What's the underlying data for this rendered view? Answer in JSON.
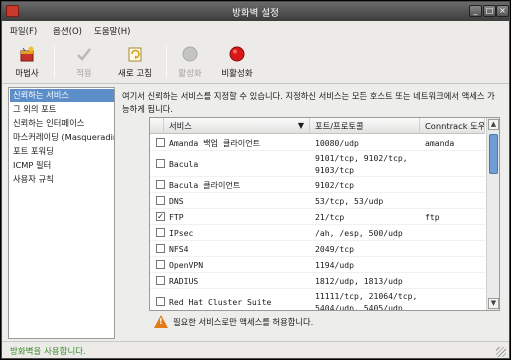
{
  "window": {
    "title": "방화벽 설정",
    "controls": [
      "_",
      "□",
      "×"
    ]
  },
  "menu": {
    "file": "파일(F)",
    "options": "옵션(O)",
    "help": "도움말(H)"
  },
  "toolbar": {
    "wizard": "마법사",
    "apply": "적용",
    "reload": "새로 고침",
    "enable": "활성화",
    "disable": "비활성화"
  },
  "sidebar": {
    "items": [
      "신뢰하는 서비스",
      "그 외의 포트",
      "신뢰하는 인터페이스",
      "마스커레이딩 (Masquerading)",
      "포트 포워딩",
      "ICMP 필터",
      "사용자 규칙"
    ],
    "selected": 0
  },
  "main": {
    "description": "여기서 신뢰하는 서비스를 지정할 수 있습니다. 지정하신 서비스는 모든 호스트 또는 네트워크에서 액세스 가능하게 됩니다.",
    "columns": {
      "service": "서비스",
      "port": "포트/프로토콜",
      "conntrack": "Conntrack 도우미"
    },
    "rows": [
      {
        "checked": false,
        "service": "Amanda 백업 클라이언트",
        "port": [
          "10080/udp"
        ],
        "conntrack": "amanda"
      },
      {
        "checked": false,
        "service": "Bacula",
        "port": [
          "9101/tcp, 9102/tcp,",
          "9103/tcp"
        ],
        "conntrack": ""
      },
      {
        "checked": false,
        "service": "Bacula 클라이언트",
        "port": [
          "9102/tcp"
        ],
        "conntrack": ""
      },
      {
        "checked": false,
        "service": "DNS",
        "port": [
          "53/tcp, 53/udp"
        ],
        "conntrack": ""
      },
      {
        "checked": true,
        "service": "FTP",
        "port": [
          "21/tcp"
        ],
        "conntrack": "ftp"
      },
      {
        "checked": false,
        "service": "IPsec",
        "port": [
          "/ah, /esp, 500/udp"
        ],
        "conntrack": ""
      },
      {
        "checked": false,
        "service": "NFS4",
        "port": [
          "2049/tcp"
        ],
        "conntrack": ""
      },
      {
        "checked": false,
        "service": "OpenVPN",
        "port": [
          "1194/udp"
        ],
        "conntrack": ""
      },
      {
        "checked": false,
        "service": "RADIUS",
        "port": [
          "1812/udp, 1813/udp"
        ],
        "conntrack": ""
      },
      {
        "checked": false,
        "service": "Red Hat Cluster Suite",
        "port": [
          "11111/tcp, 21064/tcp,",
          "5404/udp, 5405/udp"
        ],
        "conntrack": ""
      }
    ],
    "warning": "필요한 서비스로만 액세스를 허용합니다."
  },
  "status": {
    "text": "방화벽을 사용합니다."
  },
  "colors": {
    "selection": "#5c8fc9",
    "status_green": "#3a8a2a",
    "warning_orange": "#e07d18"
  }
}
